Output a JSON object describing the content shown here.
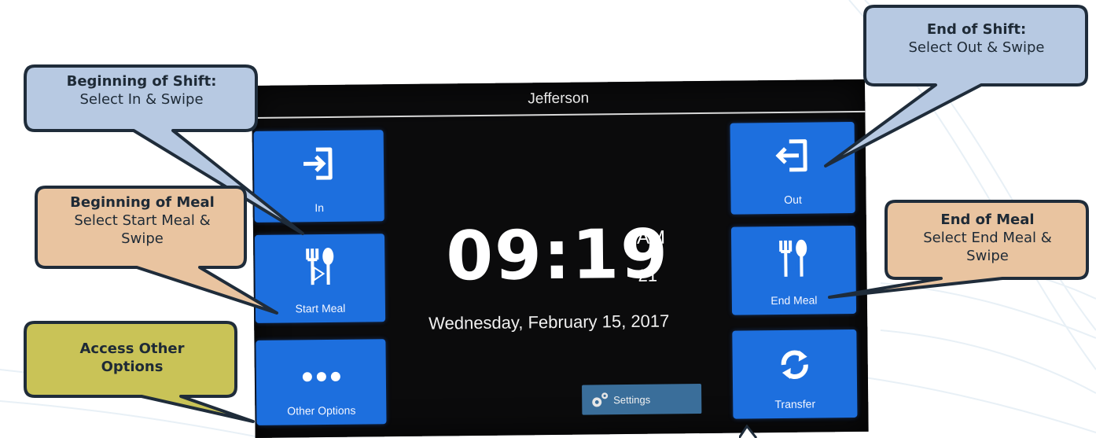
{
  "screen": {
    "title": "Jefferson",
    "time": "09:19",
    "ampm": "AM",
    "seconds": "21",
    "date": "Wednesday, February 15, 2017"
  },
  "buttons": {
    "in": "In",
    "start_meal": "Start Meal",
    "other_options": "Other Options",
    "out": "Out",
    "end_meal": "End Meal",
    "transfer": "Transfer",
    "settings": "Settings"
  },
  "callouts": {
    "beginning_shift": {
      "title": "Beginning of Shift:",
      "body": "Select In & Swipe"
    },
    "end_shift": {
      "title": "End of Shift:",
      "body": "Select Out & Swipe"
    },
    "beginning_meal": {
      "title": "Beginning of Meal",
      "body1": "Select Start Meal &",
      "body2": "Swipe"
    },
    "end_meal": {
      "title": "End of Meal",
      "body1": "Select End Meal &",
      "body2": "Swipe"
    },
    "other_options": {
      "title1": "Access Other",
      "title2": "Options"
    }
  },
  "colors": {
    "tile_blue": "#1d6fde",
    "callout_blue": "#b7c9e2",
    "callout_tan": "#e9c4a0",
    "callout_olive": "#c9c357",
    "callout_border": "#1f2c3a"
  },
  "icons": [
    "sign-in-icon",
    "sign-out-icon",
    "meal-start-icon",
    "meal-end-icon",
    "more-dots-icon",
    "transfer-icon",
    "gear-icon"
  ]
}
